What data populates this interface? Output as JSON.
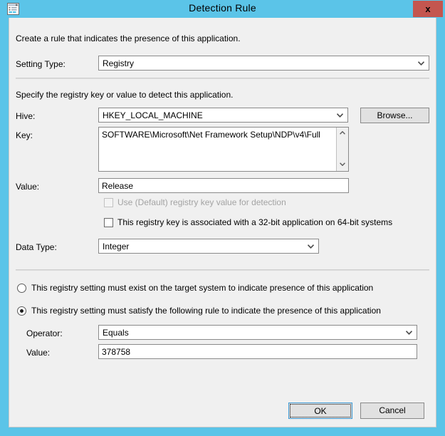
{
  "window": {
    "title": "Detection Rule",
    "icon": "registry-rule-icon",
    "close_label": "x",
    "titlebar_color": "#5bc4e8",
    "close_color": "#c4564f",
    "body_color": "#f0f0f0"
  },
  "intro": {
    "text": "Create a rule that indicates the presence of this application."
  },
  "setting_type": {
    "label": "Setting Type:",
    "value": "Registry"
  },
  "registry_section": {
    "description": "Specify the registry key or value to detect this application.",
    "hive": {
      "label": "Hive:",
      "value": "HKEY_LOCAL_MACHINE"
    },
    "browse_label": "Browse...",
    "key": {
      "label": "Key:",
      "value": "SOFTWARE\\Microsoft\\Net Framework Setup\\NDP\\v4\\Full"
    },
    "value_field": {
      "label": "Value:",
      "value": "Release"
    },
    "use_default_checkbox": {
      "label": "Use (Default) registry key value for detection",
      "checked": false,
      "enabled": false
    },
    "wow64_checkbox": {
      "label": "This registry key is associated with a 32-bit application on 64-bit systems",
      "checked": false,
      "enabled": true
    },
    "data_type": {
      "label": "Data Type:",
      "value": "Integer"
    }
  },
  "rule_options": {
    "must_exist": {
      "label": "This registry setting must exist on the target system to indicate presence of this application",
      "selected": false
    },
    "must_satisfy": {
      "label": "This registry setting must satisfy the following rule to indicate the presence of this application",
      "selected": true
    },
    "operator": {
      "label": "Operator:",
      "value": "Equals"
    },
    "value": {
      "label": "Value:",
      "value": "378758"
    }
  },
  "footer": {
    "ok_label": "OK",
    "cancel_label": "Cancel"
  }
}
